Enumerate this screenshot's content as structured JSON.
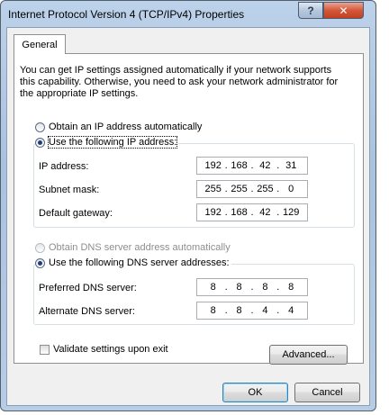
{
  "window": {
    "title": "Internet Protocol Version 4 (TCP/IPv4) Properties",
    "help_label": "?",
    "close_label": "✕"
  },
  "tabs": [
    {
      "label": "General"
    }
  ],
  "intro_text": "You can get IP settings assigned automatically if your network supports this capability. Otherwise, you need to ask your network administrator for the appropriate IP settings.",
  "ip_mode": {
    "auto_label": "Obtain an IP address automatically",
    "manual_label": "Use the following IP address:",
    "selected": "manual"
  },
  "ip_fields": {
    "ip_address": {
      "label": "IP address:",
      "value": [
        "192",
        "168",
        "42",
        "31"
      ]
    },
    "subnet_mask": {
      "label": "Subnet mask:",
      "value": [
        "255",
        "255",
        "255",
        "0"
      ]
    },
    "default_gateway": {
      "label": "Default gateway:",
      "value": [
        "192",
        "168",
        "42",
        "129"
      ]
    }
  },
  "dns_mode": {
    "auto_label": "Obtain DNS server address automatically",
    "manual_label": "Use the following DNS server addresses:",
    "selected": "manual"
  },
  "dns_fields": {
    "preferred": {
      "label": "Preferred DNS server:",
      "value": [
        "8",
        "8",
        "8",
        "8"
      ]
    },
    "alternate": {
      "label": "Alternate DNS server:",
      "value": [
        "8",
        "8",
        "4",
        "4"
      ]
    }
  },
  "validate_label": "Validate settings upon exit",
  "buttons": {
    "advanced": "Advanced...",
    "ok": "OK",
    "cancel": "Cancel"
  },
  "colors": {
    "title_bar": "#a9c2df",
    "close_button": "#c23f1f",
    "panel_bg": "#f0f0f0"
  }
}
